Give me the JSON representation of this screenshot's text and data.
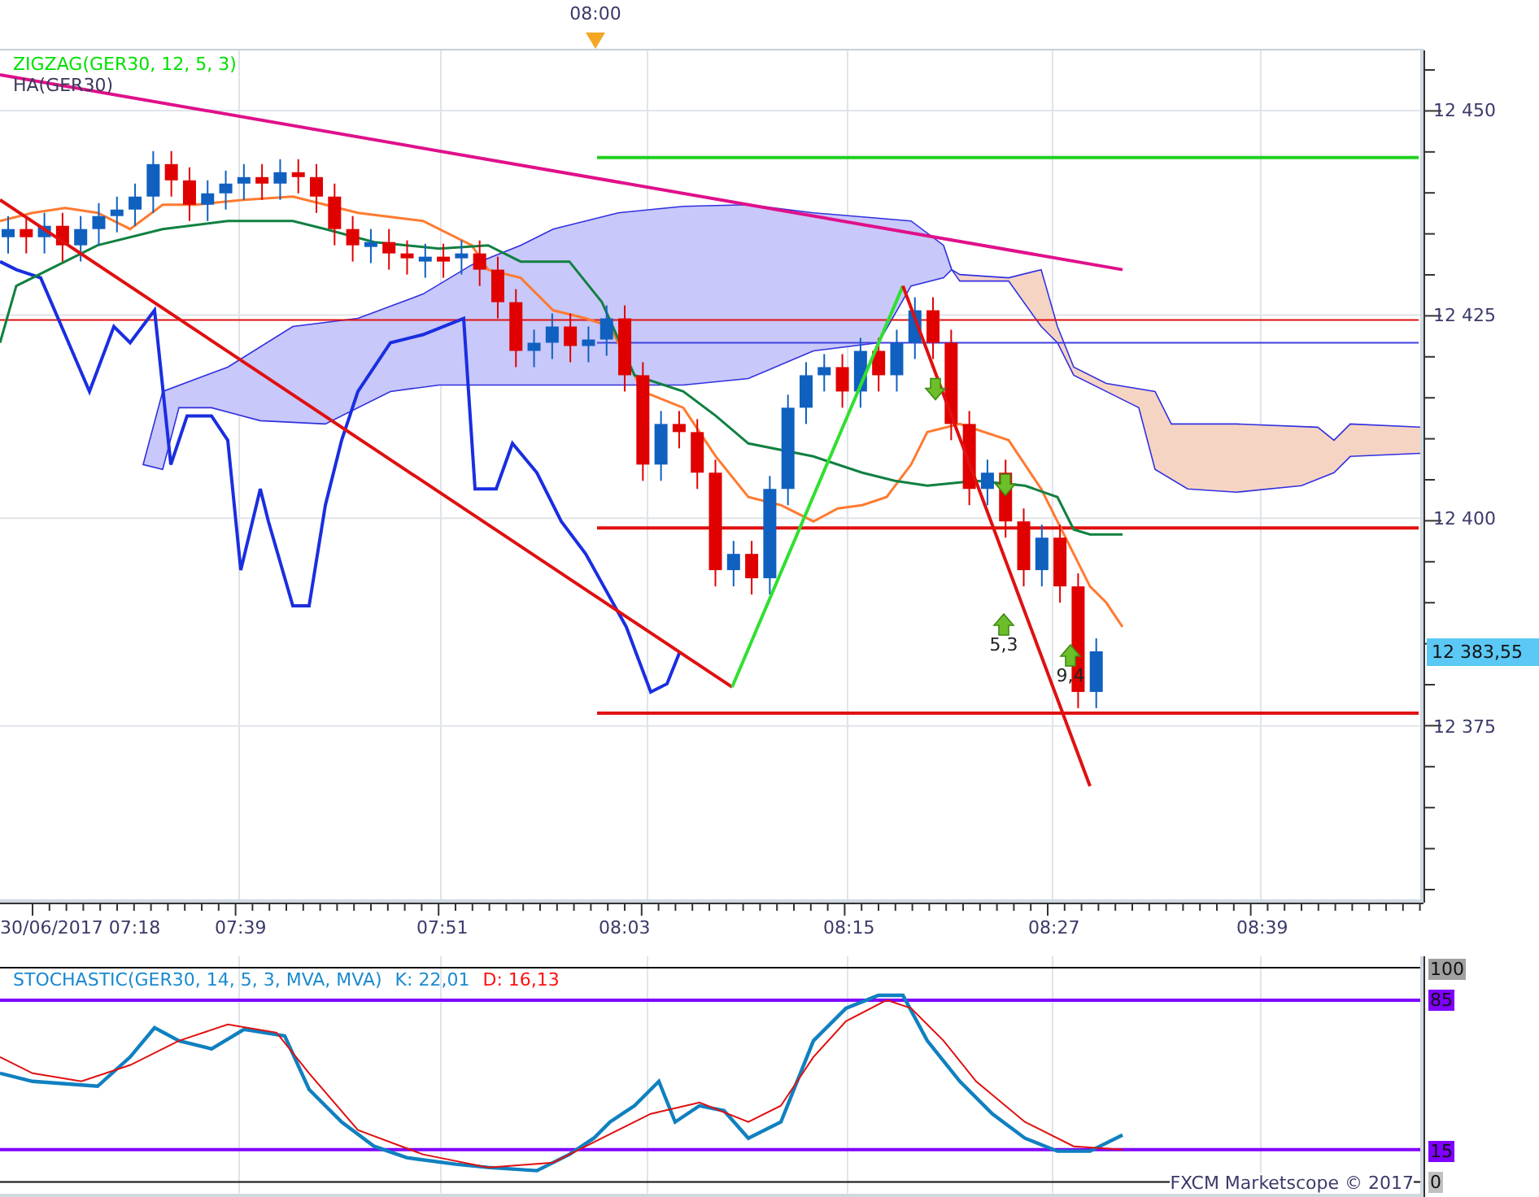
{
  "top_axis": {
    "marker_label": "08:00"
  },
  "main_chart": {
    "indicators": [
      {
        "label": "ZIGZAG(GER30, 12, 5, 3)",
        "color": "#00e000"
      },
      {
        "label": "HA(GER30)",
        "color": "#3a3a5a"
      }
    ],
    "signals": [
      {
        "label": "5,3"
      },
      {
        "label": "9,4"
      }
    ],
    "price_axis": [
      "12 450",
      "12 425",
      "12 400",
      "12 375"
    ],
    "current_price": "12 383,55"
  },
  "time_axis": [
    "30/06/2017 07:18",
    "07:39",
    "07:51",
    "08:03",
    "08:15",
    "08:27",
    "08:39"
  ],
  "stochastic": {
    "title": "STOCHASTIC(GER30, 14, 5, 3, MVA, MVA)",
    "k_label": "K: 22,01",
    "d_label": "D: 16,13",
    "levels": [
      {
        "label": "100",
        "color": "#a0a0a0"
      },
      {
        "label": "85",
        "color": "#8000ff"
      },
      {
        "label": "15",
        "color": "#8000ff"
      },
      {
        "label": "0",
        "color": "#c0c0c0"
      }
    ],
    "copyright": "FXCM Marketscope © 2017"
  }
}
